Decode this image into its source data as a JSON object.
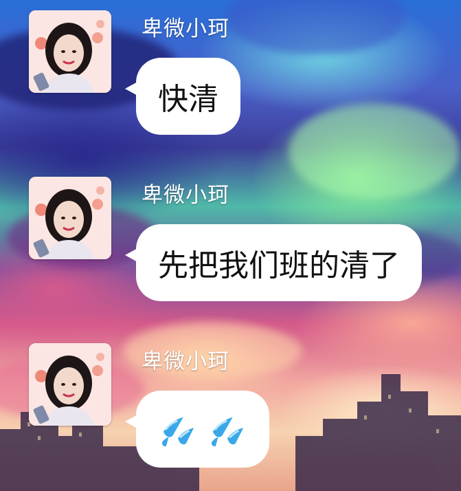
{
  "chat": {
    "messages": [
      {
        "sender": "卑微小珂",
        "text": "快清"
      },
      {
        "sender": "卑微小珂",
        "text": "先把我们班的清了"
      },
      {
        "sender": "卑微小珂",
        "emoji": [
          "sweat-droplets-icon",
          "sweat-droplets-icon"
        ]
      }
    ]
  },
  "colors": {
    "bubble": "#ffffff",
    "sender_text": "#ffffff",
    "message_text": "#111111",
    "emoji_blue": "#3aa8e8"
  }
}
